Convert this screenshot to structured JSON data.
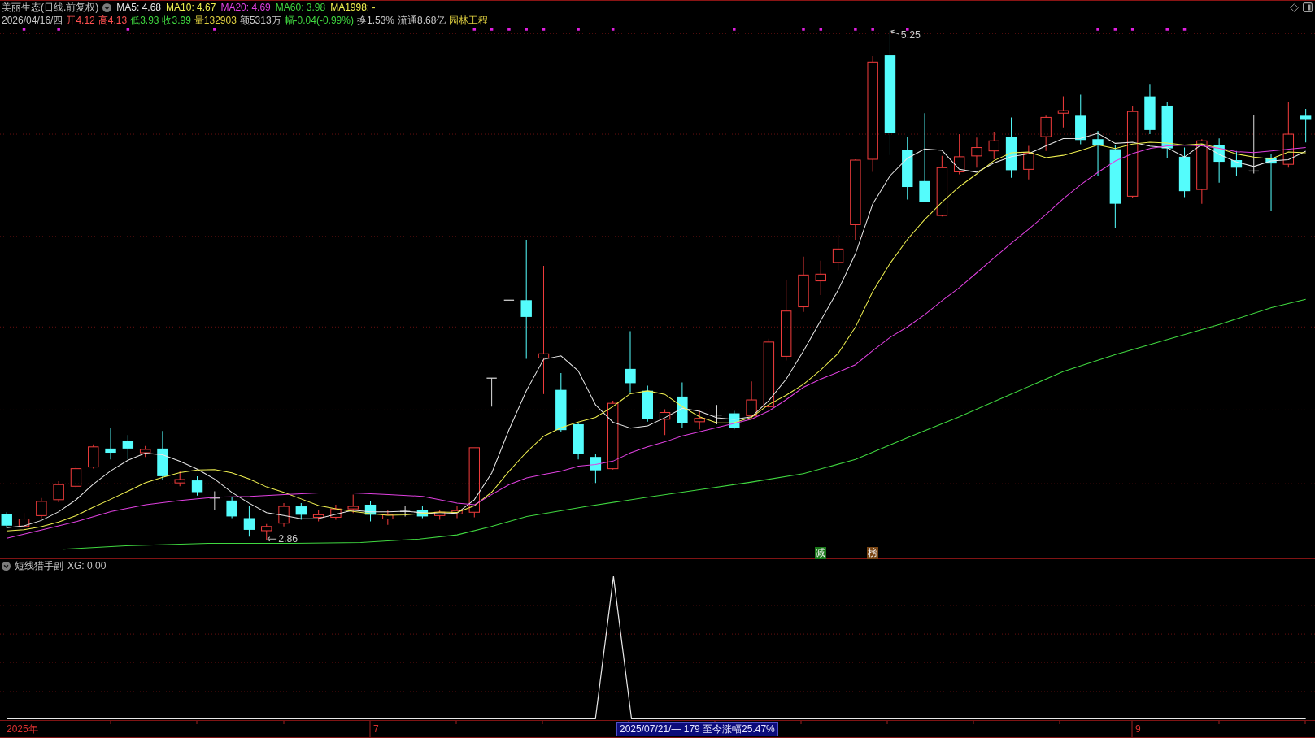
{
  "header": {
    "title": "美丽生态(日线.前复权)",
    "moving_averages": [
      {
        "label": "MA5: 4.68",
        "color": "#e8e8e8"
      },
      {
        "label": "MA10: 4.67",
        "color": "#f0f050"
      },
      {
        "label": "MA20: 4.69",
        "color": "#e040e0"
      },
      {
        "label": "MA60: 3.98",
        "color": "#40d840"
      },
      {
        "label": "MA1998: -",
        "color": "#f0f050"
      }
    ]
  },
  "quote": [
    {
      "text": "2026/04/16/四",
      "color": "#c8c8c8"
    },
    {
      "text": "开4.12",
      "color": "#ff5050"
    },
    {
      "text": "高4.13",
      "color": "#ff5050"
    },
    {
      "text": "低3.93",
      "color": "#40d840"
    },
    {
      "text": "收3.99",
      "color": "#40d840"
    },
    {
      "text": "量132903",
      "color": "#e0d040"
    },
    {
      "text": "额5313万",
      "color": "#c8c8c8"
    },
    {
      "text": "幅-0.04(-0.99%)",
      "color": "#40d840"
    },
    {
      "text": "换1.53%",
      "color": "#c8c8c8"
    },
    {
      "text": "流通8.68亿",
      "color": "#c8c8c8"
    },
    {
      "text": "园林工程",
      "color": "#e0d040"
    }
  ],
  "price_chart": {
    "high_label": "5.25",
    "low_label": "2.86",
    "signals": [
      {
        "text": "减",
        "color": "#1a7a1a"
      },
      {
        "text": "榜",
        "color": "#7a4614"
      }
    ]
  },
  "indicator_panel": {
    "title": "短线猎手副",
    "reading": "XG: 0.00"
  },
  "time_axis": {
    "labels": [
      "2025年",
      "7",
      "9"
    ],
    "range_info": "2025/07/21/— 179 至今涨幅25.47%"
  }
}
